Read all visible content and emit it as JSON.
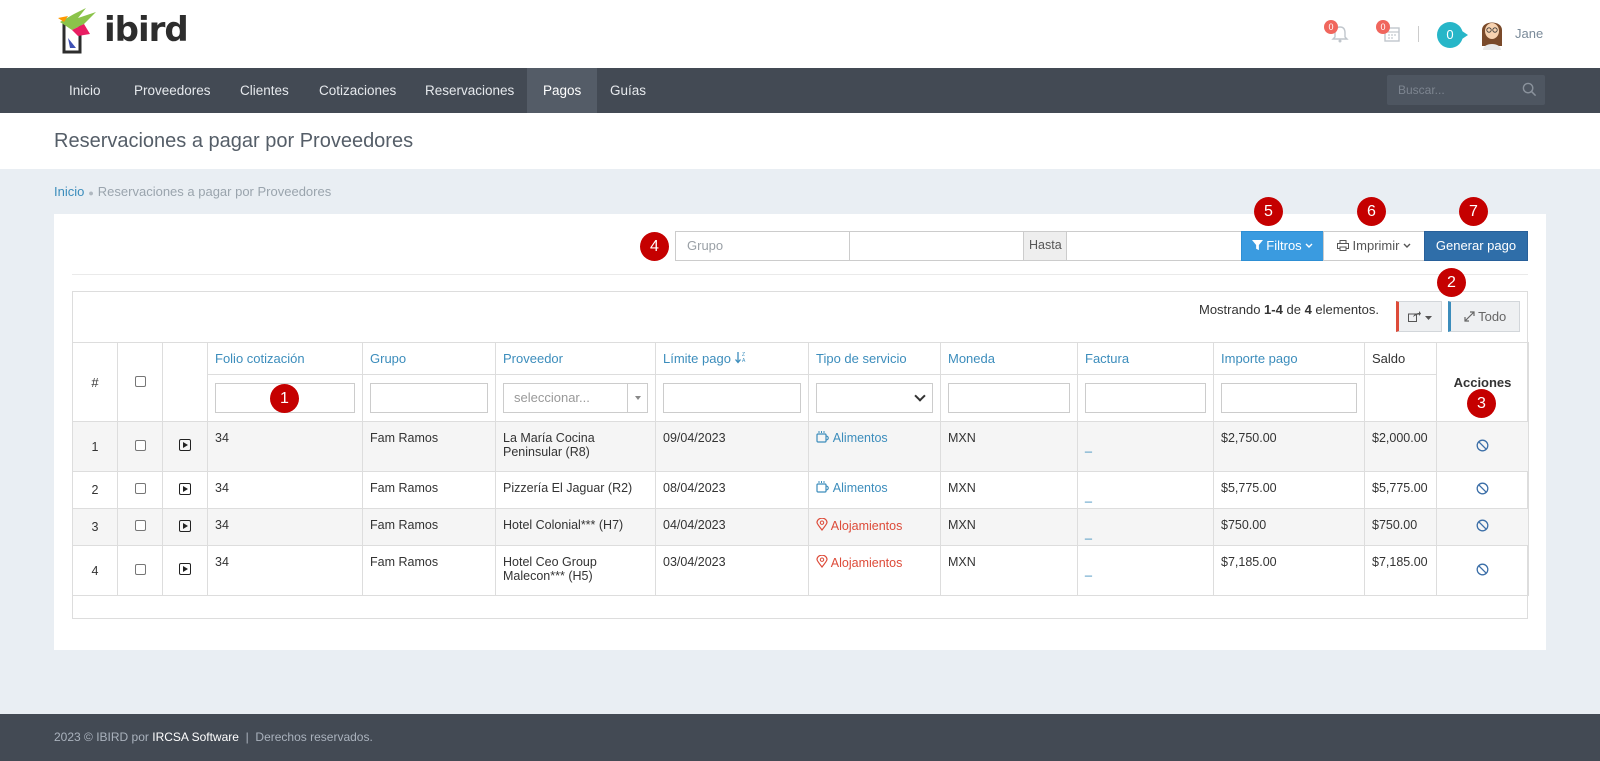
{
  "brand": {
    "name": "ibird"
  },
  "header": {
    "notifications_count": "0",
    "calendar_count": "0",
    "chat_count": "0",
    "username": "Jane"
  },
  "nav": {
    "items": [
      "Inicio",
      "Proveedores",
      "Clientes",
      "Cotizaciones",
      "Reservaciones",
      "Pagos",
      "Guías"
    ],
    "active": "Pagos",
    "search_placeholder": "Buscar..."
  },
  "page": {
    "title": "Reservaciones a pagar por Proveedores",
    "breadcrumb": [
      "Inicio",
      "Reservaciones a pagar por Proveedores"
    ]
  },
  "toolbar": {
    "group_placeholder": "Grupo",
    "date_from_value": "",
    "until_label": "Hasta",
    "date_to_value": "",
    "filters_label": "Filtros",
    "print_label": "Imprimir",
    "generate_label": "Generar pago"
  },
  "grid": {
    "summary_prefix": "Mostrando",
    "summary_range": "1-4",
    "summary_mid": "de",
    "summary_total": "4",
    "summary_suffix": "elementos.",
    "all_label": "Todo",
    "columns": [
      "#",
      "",
      "",
      "Folio cotización",
      "Grupo",
      "Proveedor",
      "Límite pago",
      "Tipo de servicio",
      "Moneda",
      "Factura",
      "Importe pago",
      "Saldo",
      "Acciones"
    ],
    "provider_select_placeholder": "seleccionar...",
    "rows": [
      {
        "num": "1",
        "folio": "34",
        "grupo": "Fam Ramos",
        "proveedor": "La María Cocina Peninsular (R8)",
        "limite": "09/04/2023",
        "servicio": "Alimentos",
        "servicio_type": "food",
        "moneda": "MXN",
        "factura": "_",
        "importe": "$2,750.00",
        "saldo": "$2,000.00"
      },
      {
        "num": "2",
        "folio": "34",
        "grupo": "Fam Ramos",
        "proveedor": "Pizzería El Jaguar (R2)",
        "limite": "08/04/2023",
        "servicio": "Alimentos",
        "servicio_type": "food",
        "moneda": "MXN",
        "factura": "_",
        "importe": "$5,775.00",
        "saldo": "$5,775.00"
      },
      {
        "num": "3",
        "folio": "34",
        "grupo": "Fam Ramos",
        "proveedor": "Hotel Colonial*** (H7)",
        "limite": "04/04/2023",
        "servicio": "Alojamientos",
        "servicio_type": "hotel",
        "moneda": "MXN",
        "factura": "_",
        "importe": "$750.00",
        "saldo": "$750.00"
      },
      {
        "num": "4",
        "folio": "34",
        "grupo": "Fam Ramos",
        "proveedor": "Hotel Ceo Group Malecon*** (H5)",
        "limite": "03/04/2023",
        "servicio": "Alojamientos",
        "servicio_type": "hotel",
        "moneda": "MXN",
        "factura": "_",
        "importe": "$7,185.00",
        "saldo": "$7,185.00"
      }
    ]
  },
  "markers": [
    "1",
    "2",
    "3",
    "4",
    "5",
    "6",
    "7"
  ],
  "footer": {
    "prefix": "2023 © IBIRD por",
    "company": "IRCSA Software",
    "sep": "|",
    "rights": "Derechos reservados."
  },
  "colors": {
    "nav_bg": "#434a54",
    "link": "#3c8dbc",
    "primary": "#2f6ea9",
    "info": "#3a9be0",
    "danger": "#dd4b39",
    "marker": "#c50000"
  }
}
